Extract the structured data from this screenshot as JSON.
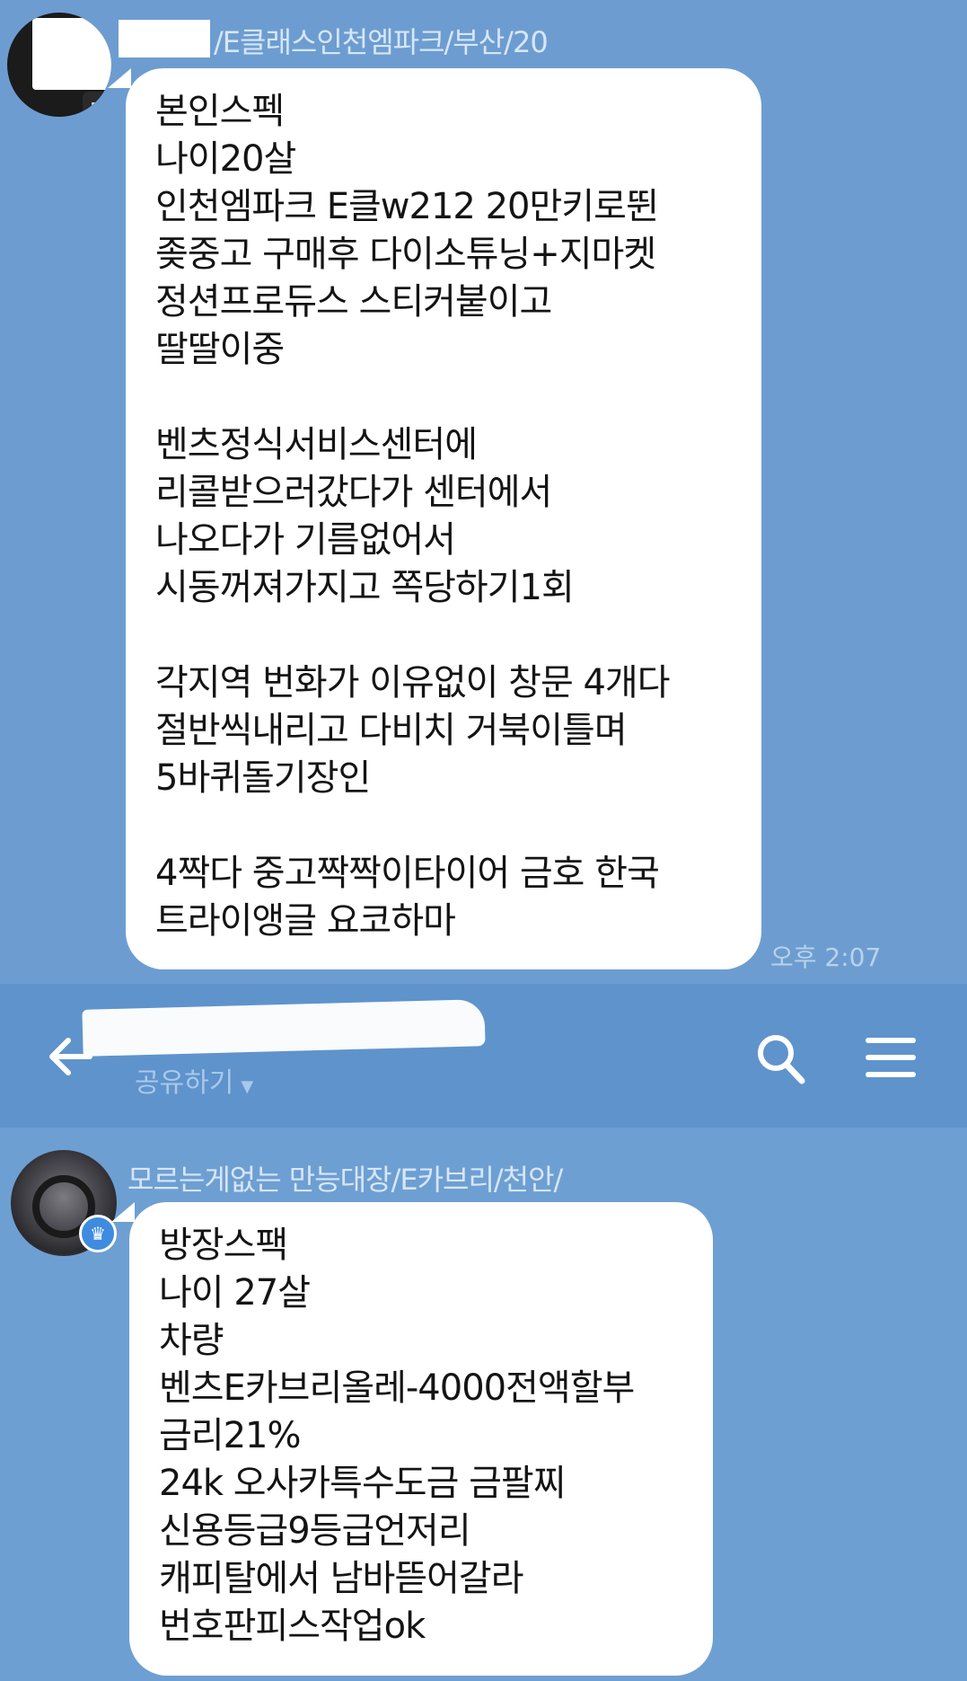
{
  "top_message": {
    "sender": "/E클래스인천엠파크/부산/20",
    "text": "본인스펙\n나이20살\n인천엠파크 E클w212 20만키로뛴\n좆중고 구매후 다이소튜닝+지마켓\n정션프로듀스 스티커붙이고\n딸딸이중\n\n벤츠정식서비스센터에\n리콜받으러갔다가 센터에서\n나오다가 기름없어서\n시동꺼져가지고 쪽당하기1회\n\n각지역 번화가 이유없이 창문 4개다\n절반씩내리고 다비치 거북이틀며\n5바퀴돌기장인\n\n4짝다 중고짝짝이타이어 금호 한국\n트라이앵글 요코하마",
    "time": "오후 2:07"
  },
  "header": {
    "share_label": "공유하기",
    "share_caret": "▼",
    "icons": {
      "back": "back-arrow-icon",
      "search": "search-icon",
      "menu": "menu-icon"
    }
  },
  "bottom_message": {
    "sender": "모르는게없는 만능대장/E카브리/천안/",
    "text": "방장스팩\n나이 27살\n차량\n벤츠E카브리올레-4000전액할부\n금리21%\n24k 오사카특수도금 금팔찌\n신용등급9등급언저리\n캐피탈에서 남바뜯어갈라\n번호판피스작업ok"
  },
  "colors": {
    "chat_background": "#6d9dd0",
    "header_background": "#5f93cc",
    "bubble": "#ffffff",
    "sender_text": "#d6e6f7",
    "admin_badge": "#3f8be0"
  }
}
